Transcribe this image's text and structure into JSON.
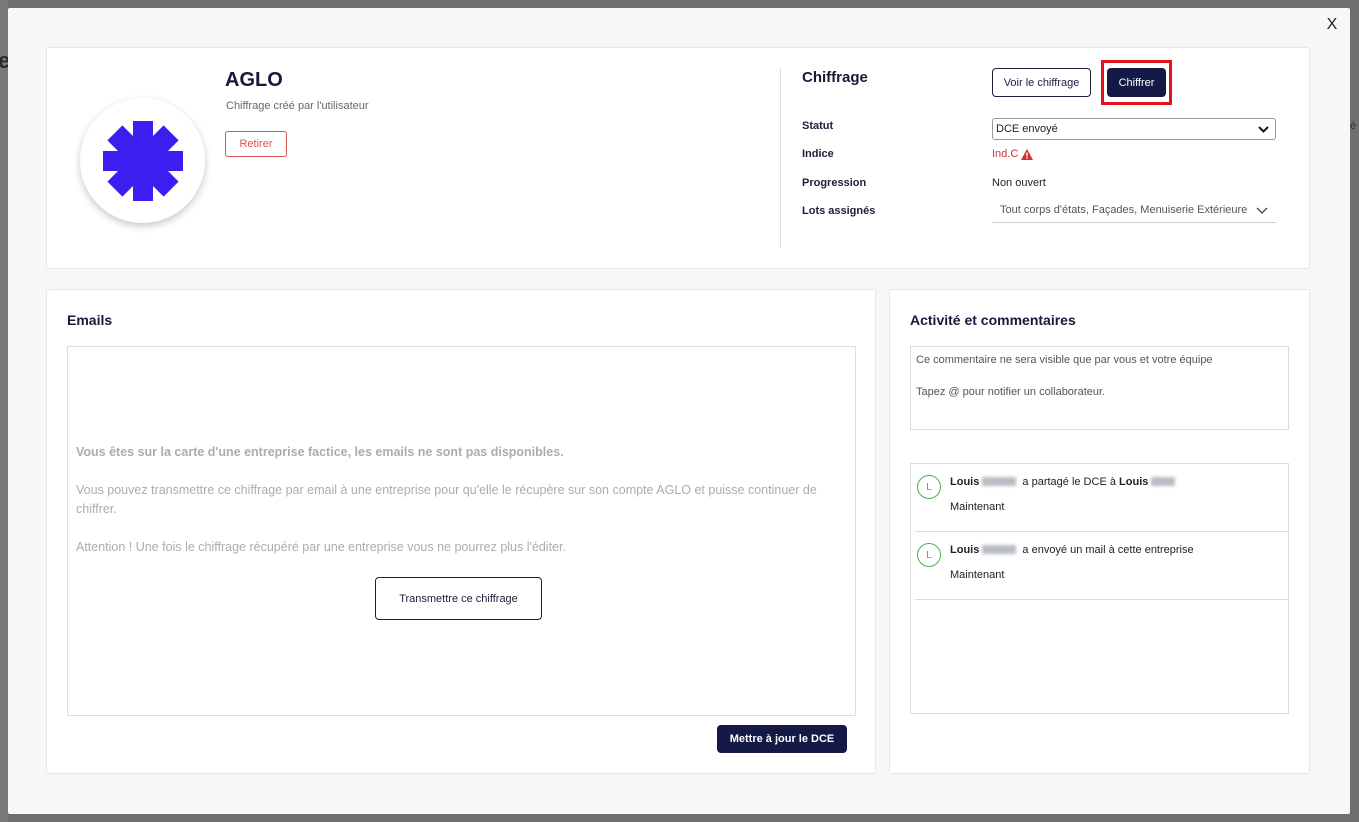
{
  "modal": {
    "close_label": "X"
  },
  "company": {
    "name": "AGLO",
    "subtitle": "Chiffrage créé par l'utilisateur",
    "remove_label": "Retirer"
  },
  "chiffrage": {
    "title": "Chiffrage",
    "view_button": "Voir le chiffrage",
    "chiffrer_button": "Chiffrer",
    "fields": {
      "statut_label": "Statut",
      "statut_value": "DCE envoyé",
      "indice_label": "Indice",
      "indice_value": "Ind.C",
      "progression_label": "Progression",
      "progression_value": "Non ouvert",
      "lots_label": "Lots assignés",
      "lots_value": "Tout corps d'états, Façades, Menuiserie Extérieure"
    }
  },
  "emails": {
    "title": "Emails",
    "notice_bold": "Vous êtes sur la carte d'une entreprise factice, les emails ne sont pas disponibles.",
    "notice_text": "Vous pouvez transmettre ce chiffrage par email à une entreprise pour qu'elle le récupère sur son compte AGLO et puisse continuer de chiffrer.",
    "notice_warning": "Attention ! Une fois le chiffrage récupéré par une entreprise vous ne pourrez plus l'éditer.",
    "transmit_button": "Transmettre ce chiffrage",
    "update_button": "Mettre à jour le DCE"
  },
  "activity": {
    "title": "Activité et commentaires",
    "comment_placeholder_line1": "Ce commentaire ne sera visible que par vous et votre équipe",
    "comment_placeholder_line2": "Tapez @ pour notifier un collaborateur.",
    "items": [
      {
        "avatar": "L",
        "user": "Louis",
        "action": "a partagé le DCE à",
        "target": "Louis",
        "time": "Maintenant"
      },
      {
        "avatar": "L",
        "user": "Louis",
        "action": "a envoyé un mail à cette entreprise",
        "target": "",
        "time": "Maintenant"
      }
    ]
  },
  "colors": {
    "primary": "#141a45",
    "danger": "#d9534f",
    "logo": "#3d1ef0",
    "highlight": "#e0141e",
    "avatar": "#4caf50"
  }
}
